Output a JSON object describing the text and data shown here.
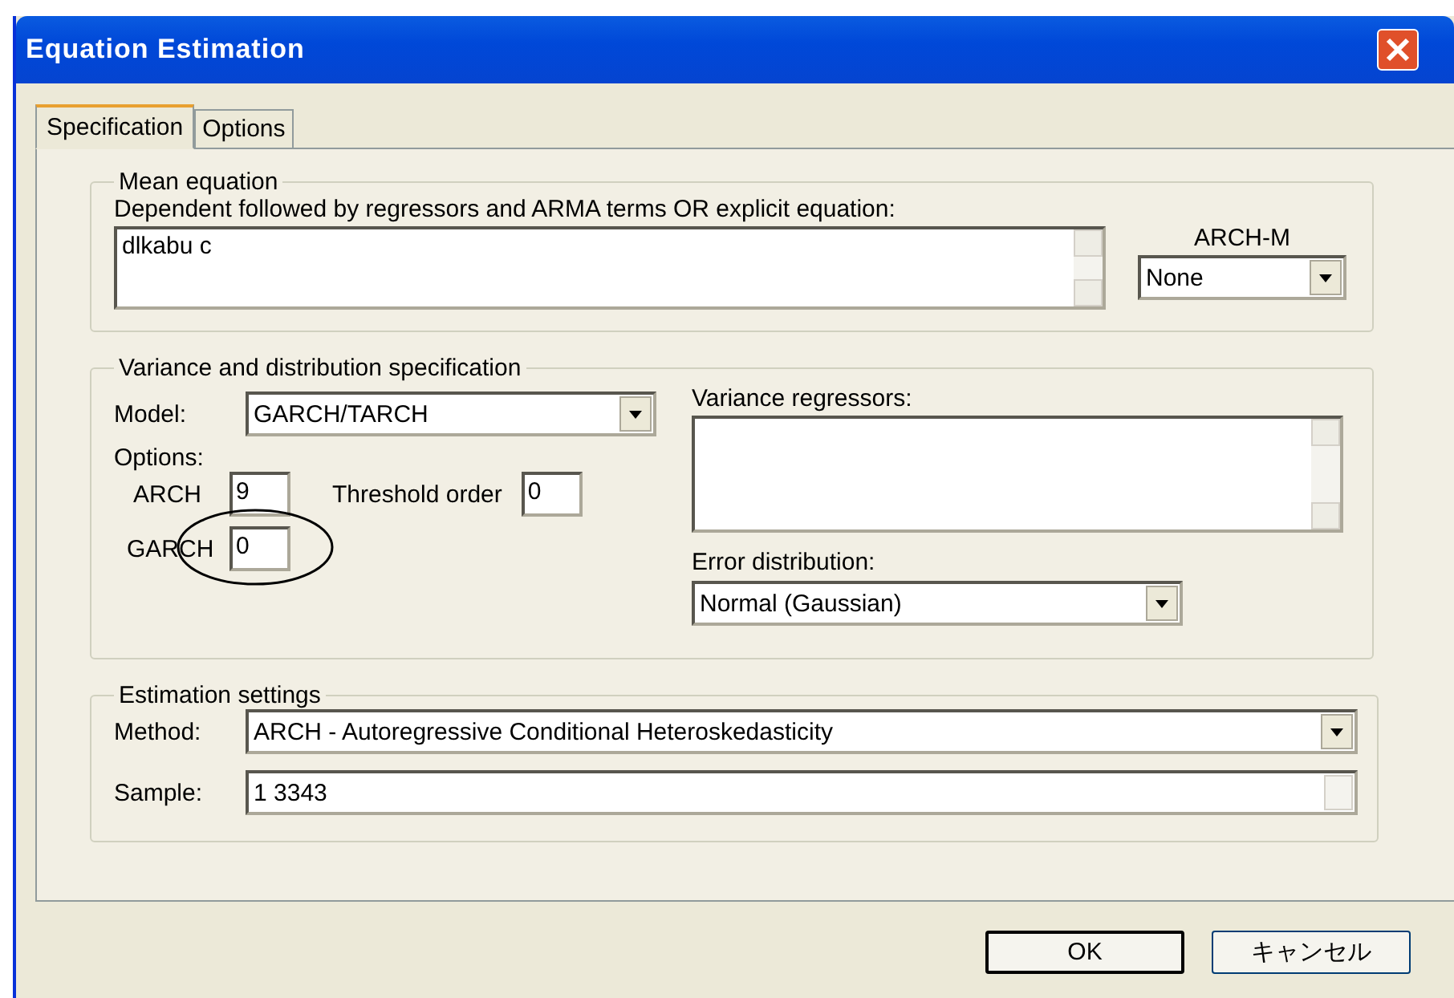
{
  "window": {
    "title": "Equation Estimation"
  },
  "tabs": [
    {
      "label": "Specification",
      "selected": true
    },
    {
      "label": "Options",
      "selected": false
    }
  ],
  "mean_equation": {
    "title": "Mean equation",
    "prompt": "Dependent followed by regressors and ARMA terms OR explicit equation:",
    "value": "dlkabu c",
    "arch_m": {
      "label": "ARCH-M",
      "value": "None"
    }
  },
  "variance": {
    "title": "Variance and distribution specification",
    "model": {
      "label": "Model:",
      "value": "GARCH/TARCH"
    },
    "options_label": "Options:",
    "arch": {
      "label": "ARCH",
      "value": "9"
    },
    "threshold": {
      "label": "Threshold order",
      "value": "0"
    },
    "garch": {
      "label": "GARCH",
      "value": "0"
    },
    "regressors_label": "Variance regressors:",
    "error": {
      "label": "Error distribution:",
      "value": "Normal (Gaussian)"
    }
  },
  "estimation": {
    "title": "Estimation settings",
    "method": {
      "label": "Method:",
      "value": "ARCH  -  Autoregressive Conditional Heteroskedasticity"
    },
    "sample": {
      "label": "Sample:",
      "value": "1 3343"
    }
  },
  "buttons": [
    "OK",
    "キャンセル"
  ]
}
